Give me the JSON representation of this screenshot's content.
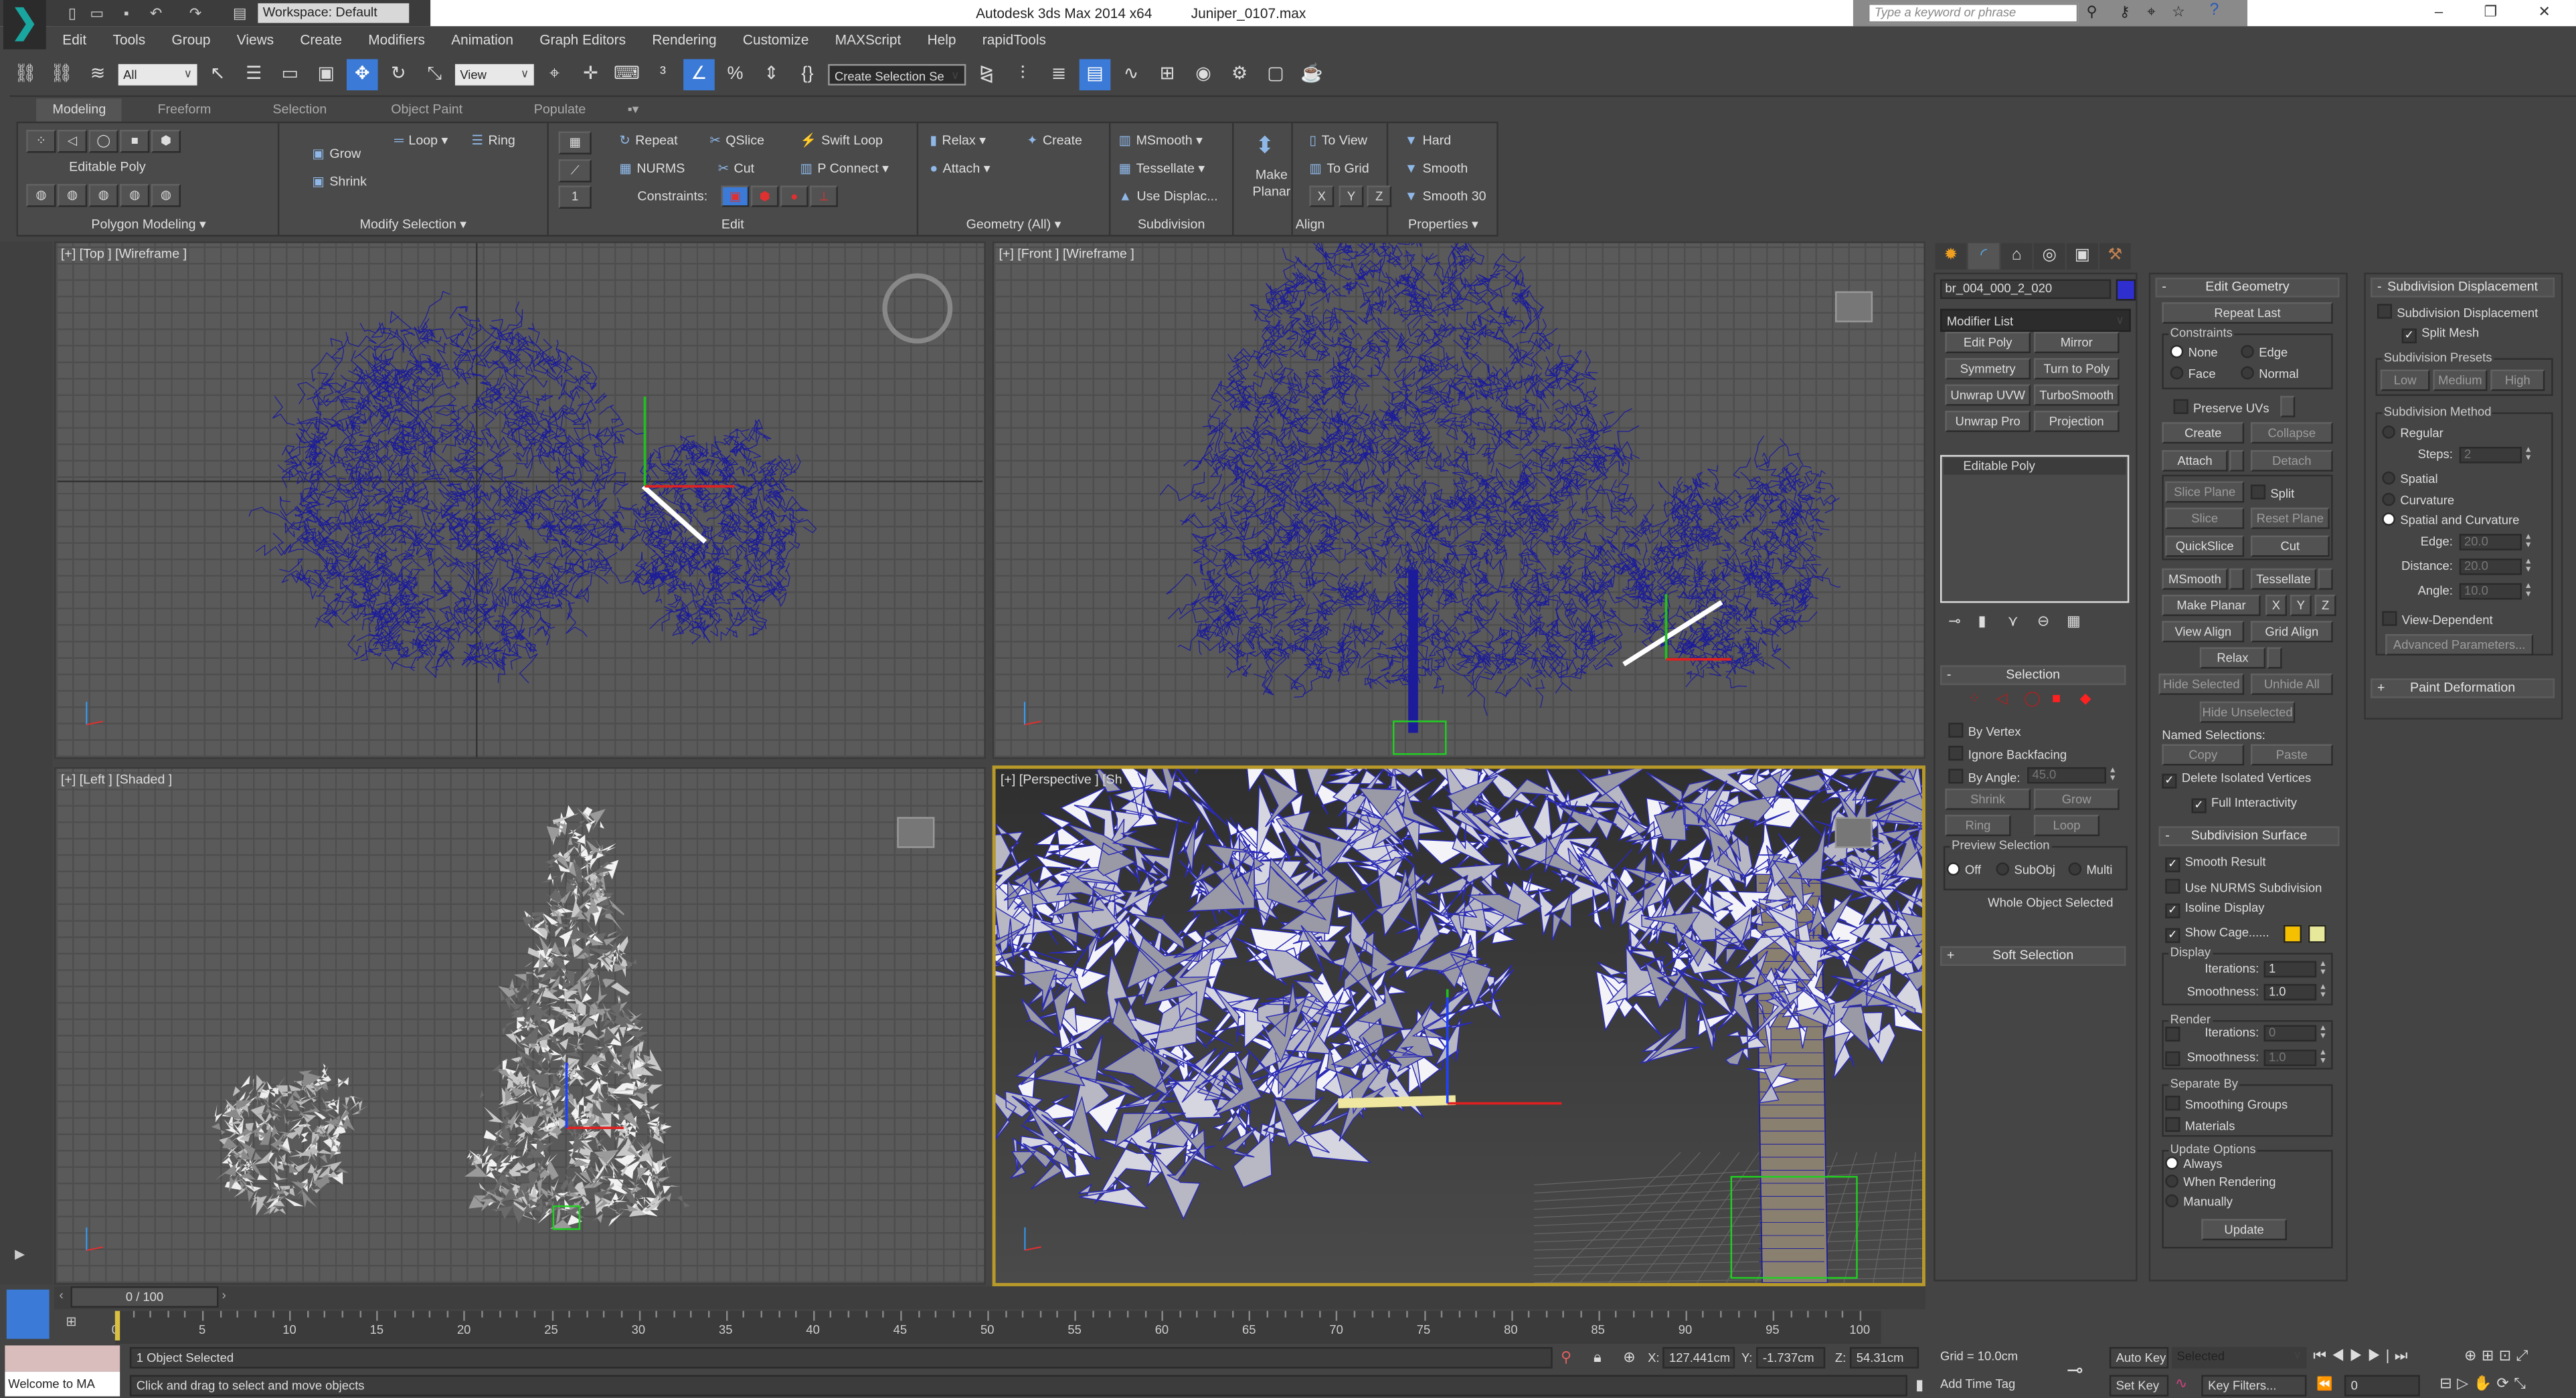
{
  "title_bar": {
    "workspace": "Workspace: Default",
    "title": "Autodesk 3ds Max  2014 x64",
    "filename": "Juniper_0107.max",
    "search_placeholder": "Type a keyword or phrase",
    "window_controls": [
      "minimize",
      "restore",
      "close"
    ]
  },
  "menu": [
    "Edit",
    "Tools",
    "Group",
    "Views",
    "Create",
    "Modifiers",
    "Animation",
    "Graph Editors",
    "Rendering",
    "Customize",
    "MAXScript",
    "Help",
    "rapidTools"
  ],
  "toolbar": {
    "selection_filter": "All",
    "ref_coord": "View",
    "named_selection": "Create Selection Se",
    "icons_a": [
      "link",
      "unlink",
      "bind-space-warp"
    ],
    "icons_b": [
      "select-object",
      "select-by-name",
      "rect-selection",
      "window-crossing",
      "select-move",
      "select-rotate",
      "select-scale"
    ],
    "icons_c": [
      "pivot-center",
      "select-manipulate",
      "keyboard-shortcut-override",
      "snaps-3d",
      "angle-snap",
      "percent-snap",
      "spinner-snap",
      "edit-named-selection"
    ],
    "icons_d": [
      "mirror",
      "align",
      "layer-manager",
      "toggle-ribbon",
      "curve-editor",
      "schematic-view",
      "material-editor",
      "render-setup",
      "rendered-frame-window",
      "render-production"
    ],
    "active": [
      "select-move",
      "angle-snap",
      "toggle-ribbon"
    ]
  },
  "ribbon": {
    "tabs": [
      "Modeling",
      "Freeform",
      "Selection",
      "Object Paint",
      "Populate"
    ],
    "active_tab": "Modeling",
    "panels": [
      "Polygon Modeling ▾",
      "Modify Selection ▾",
      "Edit",
      "Geometry (All) ▾",
      "Subdivision",
      "Align",
      "Properties ▾"
    ],
    "editable_poly": "Editable Poly",
    "grow": "Grow",
    "shrink": "Shrink",
    "loop": "Loop ▾",
    "ring": "Ring",
    "repeat": "Repeat",
    "nurms": "NURMS",
    "qslice": "QSlice",
    "cut": "Cut",
    "swift_loop": "Swift Loop",
    "p_connect": "P Connect ▾",
    "constraints": "Constraints:",
    "relax": "Relax ▾",
    "create": "Create",
    "attach": "Attach ▾",
    "msmooth": "MSmooth ▾",
    "tessellate": "Tessellate ▾",
    "use_displac": "Use Displac...",
    "make_planar": "Make Planar",
    "to_view": "To View",
    "to_grid": "To Grid",
    "x": "X",
    "y": "Y",
    "z": "Z",
    "hard": "Hard",
    "smooth": "Smooth",
    "smooth30": "Smooth 30"
  },
  "viewports": [
    {
      "label": "[+] [Top ] [Wireframe ]"
    },
    {
      "label": "[+] [Front ] [Wireframe ]"
    },
    {
      "label": "[+] [Left ] [Shaded ]"
    },
    {
      "label": "[+] [Perspective ] [Sh"
    }
  ],
  "colors": {
    "wire": "#1c1c9a",
    "accent": "#3b7ad6",
    "active_viewport": "#b89a2a",
    "cage1": "#f5c000",
    "cage2": "#e8e89a",
    "object_color": "#2f2fd0"
  },
  "command_panel": {
    "tabs": [
      "create",
      "modify",
      "hierarchy",
      "motion",
      "display",
      "utilities"
    ],
    "object_name": "br_004_000_2_020",
    "modifier_list": "Modifier List",
    "modifier_buttons": [
      "Edit Poly",
      "Mirror",
      "Symmetry",
      "Turn to Poly",
      "Unwrap UVW",
      "TurboSmooth",
      "Unwrap Pro",
      "Projection"
    ],
    "stack": [
      "Editable Poly"
    ],
    "selection": {
      "title": "Selection",
      "by_vertex": {
        "label": "By Vertex",
        "checked": false
      },
      "ignore_backfacing": {
        "label": "Ignore Backfacing",
        "checked": false
      },
      "by_angle": {
        "label": "By Angle:",
        "checked": false,
        "value": "45.0"
      },
      "shrink": "Shrink",
      "grow": "Grow",
      "ring": "Ring",
      "loop": "Loop",
      "preview_title": "Preview Selection",
      "preview_off": {
        "label": "Off",
        "selected": true
      },
      "preview_subobj": {
        "label": "SubObj",
        "selected": false
      },
      "preview_multi": {
        "label": "Multi",
        "selected": false
      },
      "status": "Whole Object Selected"
    },
    "soft_selection": {
      "title": "Soft Selection"
    },
    "edit_geometry": {
      "title": "Edit Geometry",
      "repeat_last": "Repeat Last",
      "constraints_title": "Constraints",
      "c_none": {
        "label": "None",
        "selected": true
      },
      "c_edge": {
        "label": "Edge",
        "selected": false
      },
      "c_face": {
        "label": "Face",
        "selected": false
      },
      "c_normal": {
        "label": "Normal",
        "selected": false
      },
      "preserve_uvs": {
        "label": "Preserve UVs",
        "checked": false
      },
      "create": "Create",
      "collapse": "Collapse",
      "attach": "Attach",
      "detach": "Detach",
      "slice_plane": "Slice Plane",
      "split": {
        "label": "Split",
        "checked": false
      },
      "slice": "Slice",
      "reset_plane": "Reset Plane",
      "quickslice": "QuickSlice",
      "cut": "Cut",
      "msmooth": "MSmooth",
      "tessellate": "Tessellate",
      "make_planar": "Make Planar",
      "x": "X",
      "y": "Y",
      "z": "Z",
      "view_align": "View Align",
      "grid_align": "Grid Align",
      "relax": "Relax",
      "hide_selected": "Hide Selected",
      "unhide_all": "Unhide All",
      "hide_unselected": "Hide Unselected",
      "named_selections": "Named Selections:",
      "copy": "Copy",
      "paste": "Paste",
      "delete_isolated": {
        "label": "Delete Isolated Vertices",
        "checked": true
      },
      "full_interactivity": {
        "label": "Full Interactivity",
        "checked": true
      }
    },
    "subdivision_surface": {
      "title": "Subdivision Surface",
      "smooth_result": {
        "label": "Smooth Result",
        "checked": true
      },
      "use_nurms": {
        "label": "Use NURMS Subdivision",
        "checked": false
      },
      "isoline": {
        "label": "Isoline Display",
        "checked": true
      },
      "show_cage": {
        "label": "Show Cage......",
        "checked": true
      },
      "display_title": "Display",
      "d_iterations": {
        "label": "Iterations:",
        "value": "1"
      },
      "d_smoothness": {
        "label": "Smoothness:",
        "value": "1.0"
      },
      "render_title": "Render",
      "r_iterations": {
        "label": "Iterations:",
        "value": "0",
        "checked": false
      },
      "r_smoothness": {
        "label": "Smoothness:",
        "value": "1.0",
        "checked": false
      },
      "separate_title": "Separate By",
      "smoothing_groups": {
        "label": "Smoothing Groups",
        "checked": false
      },
      "materials": {
        "label": "Materials",
        "checked": false
      },
      "update_title": "Update Options",
      "always": {
        "label": "Always",
        "selected": true
      },
      "when_rendering": {
        "label": "When Rendering",
        "selected": false
      },
      "manually": {
        "label": "Manually",
        "selected": false
      },
      "update": "Update"
    },
    "subdivision_displacement": {
      "title": "Subdivision Displacement",
      "enable": {
        "label": "Subdivision Displacement",
        "checked": false
      },
      "split_mesh": {
        "label": "Split Mesh",
        "checked": true
      },
      "presets_title": "Subdivision Presets",
      "low": "Low",
      "medium": "Medium",
      "high": "High",
      "method_title": "Subdivision Method",
      "regular": {
        "label": "Regular",
        "selected": false
      },
      "steps": {
        "label": "Steps:",
        "value": "2"
      },
      "spatial": {
        "label": "Spatial",
        "selected": false
      },
      "curvature": {
        "label": "Curvature",
        "selected": false
      },
      "spatial_curvature": {
        "label": "Spatial and Curvature",
        "selected": true
      },
      "edge": {
        "label": "Edge:",
        "value": "20.0"
      },
      "distance": {
        "label": "Distance:",
        "value": "20.0"
      },
      "angle": {
        "label": "Angle:",
        "value": "10.0"
      },
      "view_dependent": {
        "label": "View-Dependent",
        "checked": false
      },
      "advanced": "Advanced Parameters..."
    },
    "paint_deformation": {
      "title": "Paint Deformation"
    }
  },
  "timeline": {
    "slider": "0 / 100",
    "ticks": [
      "0",
      "5",
      "10",
      "15",
      "20",
      "25",
      "30",
      "35",
      "40",
      "45",
      "50",
      "55",
      "60",
      "65",
      "70",
      "75",
      "80",
      "85",
      "90",
      "95",
      "100"
    ]
  },
  "status": {
    "listener": "Welcome to MA",
    "selection": "1 Object Selected",
    "prompt": "Click and drag to select and move objects",
    "x": "127.441cm",
    "y": "-1.737cm",
    "z": "54.31cm",
    "x_label": "X:",
    "y_label": "Y:",
    "z_label": "Z:",
    "grid": "Grid = 10.0cm",
    "add_time_tag": "Add Time Tag",
    "auto_key": "Auto Key",
    "set_key": "Set Key",
    "key_mode": "Selected",
    "key_filters": "Key Filters...",
    "frame": "0"
  }
}
